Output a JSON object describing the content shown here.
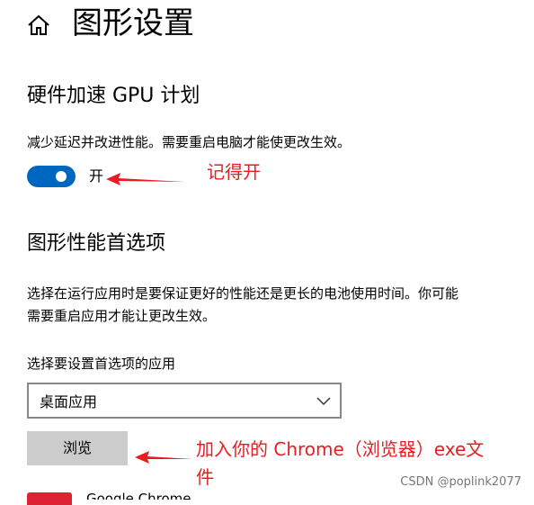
{
  "header": {
    "title": "图形设置"
  },
  "gpu_section": {
    "heading": "硬件加速 GPU 计划",
    "description": "减少延迟并改进性能。需要重启电脑才能使更改生效。",
    "toggle_state_label": "开",
    "toggle_on": true
  },
  "perf_section": {
    "heading": "图形性能首选项",
    "description_line1": "选择在运行应用时是要保证更好的性能还是更长的电池使用时间。你可能",
    "description_line2": "需要重启应用才能让更改生效。",
    "select_label": "选择要设置首选项的应用",
    "select_value": "桌面应用",
    "browse_label": "浏览"
  },
  "annotations": {
    "note1": "记得开",
    "note2_line1": "加入你的 Chrome（浏览器）exe文",
    "note2_line2": "件"
  },
  "watermark": "CSDN @poplink2077",
  "partial_list_item": "Google Chrome",
  "colors": {
    "accent": "#0067c0",
    "annotation": "#e81c23"
  },
  "icons": {
    "home": "home-icon",
    "chevron": "chevron-down-icon",
    "arrow": "arrow-left-icon"
  }
}
